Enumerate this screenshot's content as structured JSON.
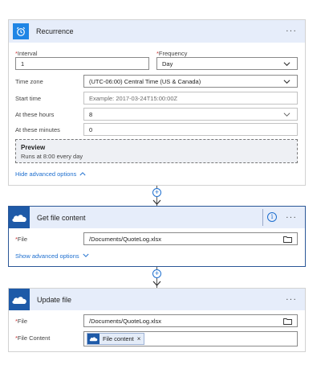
{
  "recurrence": {
    "title": "Recurrence",
    "interval_label": "Interval",
    "interval_value": "1",
    "frequency_label": "Frequency",
    "frequency_value": "Day",
    "timezone_label": "Time zone",
    "timezone_value": "(UTC-06:00) Central Time (US & Canada)",
    "starttime_label": "Start time",
    "starttime_placeholder": "Example: 2017-03-24T15:00:00Z",
    "hours_label": "At these hours",
    "hours_value": "8",
    "minutes_label": "At these minutes",
    "minutes_value": "0",
    "preview_title": "Preview",
    "preview_text": "Runs at 8:00 every day",
    "hide_advanced": "Hide advanced options",
    "menu": "···"
  },
  "get_file": {
    "title": "Get file content",
    "file_label": "File",
    "file_value": "/Documents/QuoteLog.xlsx",
    "show_advanced": "Show advanced options",
    "info_icon": "i",
    "menu": "···"
  },
  "update_file": {
    "title": "Update file",
    "file_label": "File",
    "file_value": "/Documents/QuoteLog.xlsx",
    "content_label": "File Content",
    "content_token": "File content",
    "token_remove": "×",
    "menu": "···"
  },
  "required_mark": "*",
  "plus": "+",
  "colors": {
    "recurrence_icon": "#1f85e5",
    "onedrive_icon": "#1e5aa8",
    "header_bg": "#e6edfa",
    "link": "#1e6fcf",
    "selected_border": "#2b5797"
  }
}
